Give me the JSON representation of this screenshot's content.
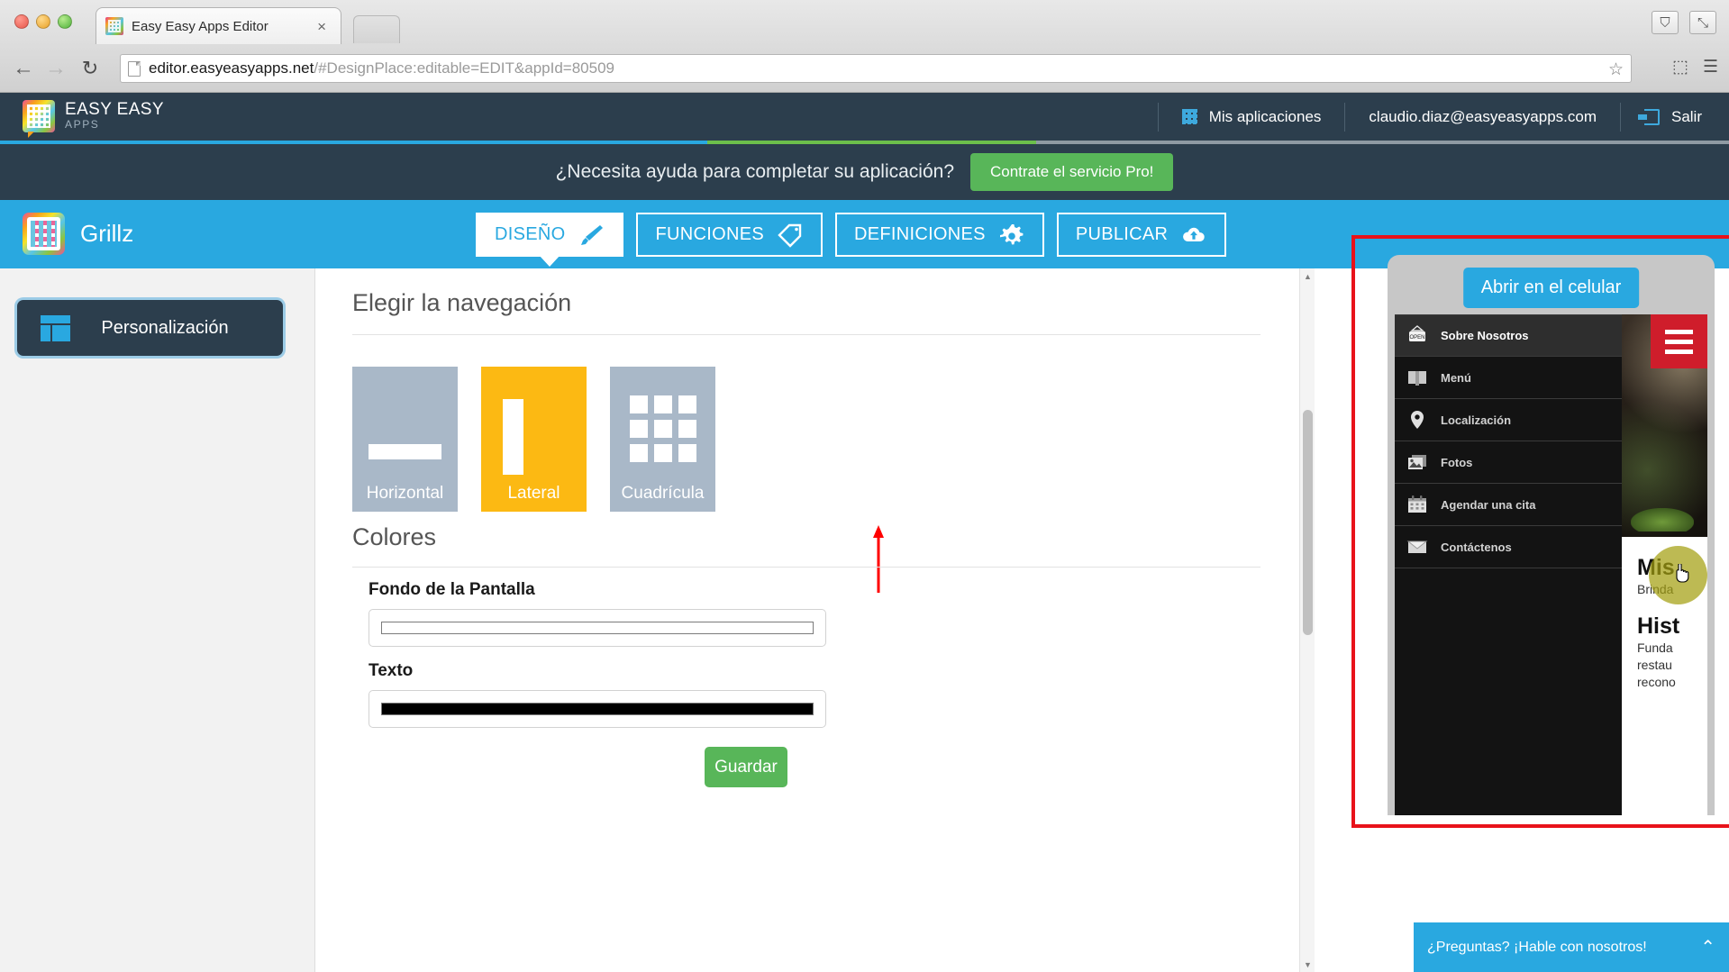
{
  "browser": {
    "tab_title": "Easy Easy Apps Editor",
    "tab_close": "×",
    "url_domain": "editor.easyeasyapps.net",
    "url_path": "/#DesignPlace:editable=EDIT&appId=80509",
    "back_icon": "←",
    "forward_icon": "→",
    "reload_icon": "↻",
    "star_icon": "☆",
    "cast_icon": "⬚",
    "menu_icon": "☰",
    "user_icon": "⛉",
    "maximize_icon": "⤡"
  },
  "header": {
    "logo_line1": "EASY EASY",
    "logo_line2": "APPS",
    "my_apps": "Mis aplicaciones",
    "account_email": "claudio.diaz@easyeasyapps.com",
    "logout": "Salir",
    "accent_colors": [
      "#29a8e0",
      "#6cbf4b",
      "#8f9aa3"
    ]
  },
  "promo": {
    "text": "¿Necesita ayuda para completar su aplicación?",
    "button": "Contrate el servicio Pro!",
    "button_color": "#58b659"
  },
  "app_bar": {
    "app_name": "Grillz",
    "background_color": "#29a8e0",
    "tabs": [
      {
        "label": "DISEÑO",
        "icon": "paintbrush-icon",
        "active": true
      },
      {
        "label": "FUNCIONES",
        "icon": "tags-icon",
        "active": false
      },
      {
        "label": "DEFINICIONES",
        "icon": "gear-icon",
        "active": false
      },
      {
        "label": "PUBLICAR",
        "icon": "cloud-upload-icon",
        "active": false
      }
    ]
  },
  "sidebar": {
    "items": [
      {
        "label": "Personalización",
        "icon": "layout-icon",
        "active": true
      }
    ]
  },
  "main": {
    "navigation_section": {
      "title": "Elegir la navegación",
      "options": [
        {
          "label": "Horizontal",
          "selected": false
        },
        {
          "label": "Lateral",
          "selected": true
        },
        {
          "label": "Cuadrícula",
          "selected": false
        }
      ],
      "selected_color": "#fcb913",
      "unselected_color": "#a9b8c8"
    },
    "colors_section": {
      "title": "Colores",
      "fields": [
        {
          "label": "Fondo de la Pantalla",
          "value": "#ffffff"
        },
        {
          "label": "Texto",
          "value": "#000000"
        }
      ]
    },
    "save_button": "Guardar"
  },
  "preview": {
    "open_mobile_button": "Abrir en el celular",
    "highlight_color": "#e8121a",
    "hamburger_color": "#cf1d2b",
    "menu_items": [
      {
        "label": "Sobre Nosotros",
        "icon": "open-sign-icon",
        "active": true
      },
      {
        "label": "Menú",
        "icon": "book-icon",
        "active": false
      },
      {
        "label": "Localización",
        "icon": "map-pin-icon",
        "active": false
      },
      {
        "label": "Fotos",
        "icon": "photos-icon",
        "active": false
      },
      {
        "label": "Agendar una cita",
        "icon": "calendar-icon",
        "active": false
      },
      {
        "label": "Contáctenos",
        "icon": "envelope-icon",
        "active": false
      }
    ],
    "content": {
      "heading_1": "Mis",
      "paragraph_1": "Brinda",
      "heading_2": "Hist",
      "paragraph_2_line1": "Funda",
      "paragraph_2_line2": "restau",
      "paragraph_2_line3": "recono"
    }
  },
  "chat": {
    "text": "¿Preguntas? ¡Hable con nosotros!",
    "caret": "⌃",
    "color": "#29a8e0"
  },
  "scrollbar": {
    "up_arrow": "▲",
    "down_arrow": "▼"
  }
}
